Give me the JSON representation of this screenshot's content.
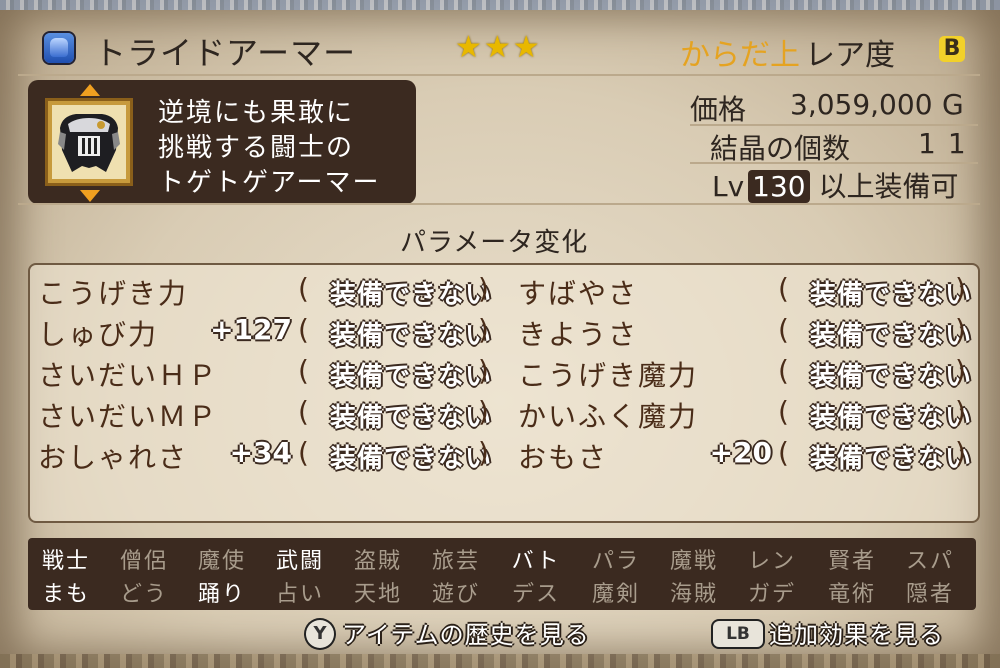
{
  "item": {
    "name": "トライドアーマー",
    "stars": "★★★",
    "category": "からだ上",
    "rarity_label": "レア度",
    "rarity_grade": "B"
  },
  "description": [
    "逆境にも果敢に",
    "挑戦する闘士の",
    "トゲトゲアーマー"
  ],
  "stats": {
    "price_label": "価格",
    "price_value": "3,059,000",
    "price_unit": "G",
    "crystal_label": "結晶の個数",
    "crystal_value": "11",
    "level_prefix": "Lv",
    "level_value": "130",
    "level_suffix": "以上装備可"
  },
  "params": {
    "title": "パラメータ変化",
    "left": [
      {
        "name": "こうげき力",
        "delta": "",
        "value": "装備できない"
      },
      {
        "name": "しゅび力",
        "delta": "+127",
        "value": "装備できない"
      },
      {
        "name": "さいだいＨＰ",
        "delta": "",
        "value": "装備できない"
      },
      {
        "name": "さいだいＭＰ",
        "delta": "",
        "value": "装備できない"
      },
      {
        "name": "おしゃれさ",
        "delta": "+34",
        "value": "装備できない"
      }
    ],
    "right": [
      {
        "name": "すばやさ",
        "delta": "",
        "value": "装備できない"
      },
      {
        "name": "きようさ",
        "delta": "",
        "value": "装備できない"
      },
      {
        "name": "こうげき魔力",
        "delta": "",
        "value": "装備できない"
      },
      {
        "name": "かいふく魔力",
        "delta": "",
        "value": "装備できない"
      },
      {
        "name": "おもさ",
        "delta": "+20",
        "value": "装備できない"
      }
    ],
    "open_paren": "(",
    "close_paren": ")"
  },
  "jobs": {
    "row1": [
      {
        "label": "戦士",
        "on": true
      },
      {
        "label": "僧侶",
        "on": false
      },
      {
        "label": "魔使",
        "on": false
      },
      {
        "label": "武闘",
        "on": true
      },
      {
        "label": "盗賊",
        "on": false
      },
      {
        "label": "旅芸",
        "on": false
      },
      {
        "label": "バト",
        "on": true
      },
      {
        "label": "パラ",
        "on": false
      },
      {
        "label": "魔戦",
        "on": false
      },
      {
        "label": "レン",
        "on": false
      },
      {
        "label": "賢者",
        "on": false
      },
      {
        "label": "スパ",
        "on": false
      }
    ],
    "row2": [
      {
        "label": "まも",
        "on": true
      },
      {
        "label": "どう",
        "on": false
      },
      {
        "label": "踊り",
        "on": true
      },
      {
        "label": "占い",
        "on": false
      },
      {
        "label": "天地",
        "on": false
      },
      {
        "label": "遊び",
        "on": false
      },
      {
        "label": "デス",
        "on": false
      },
      {
        "label": "魔剣",
        "on": false
      },
      {
        "label": "海賊",
        "on": false
      },
      {
        "label": "ガデ",
        "on": false
      },
      {
        "label": "竜術",
        "on": false
      },
      {
        "label": "隠者",
        "on": false
      }
    ]
  },
  "footer": {
    "y_button": "Y",
    "y_label": "アイテムの歴史を見る",
    "lb_button": "LB",
    "lb_label": "追加効果を見る"
  },
  "colors": {
    "panel_dark": "#3b2a20",
    "category": "#e5a321",
    "star": "#e8b800",
    "grade_badge": "#f2d12a"
  },
  "icons": [
    "armor-category-icon",
    "armor-thumbnail-icon",
    "scroll-up-arrow-icon",
    "scroll-down-arrow-icon"
  ]
}
